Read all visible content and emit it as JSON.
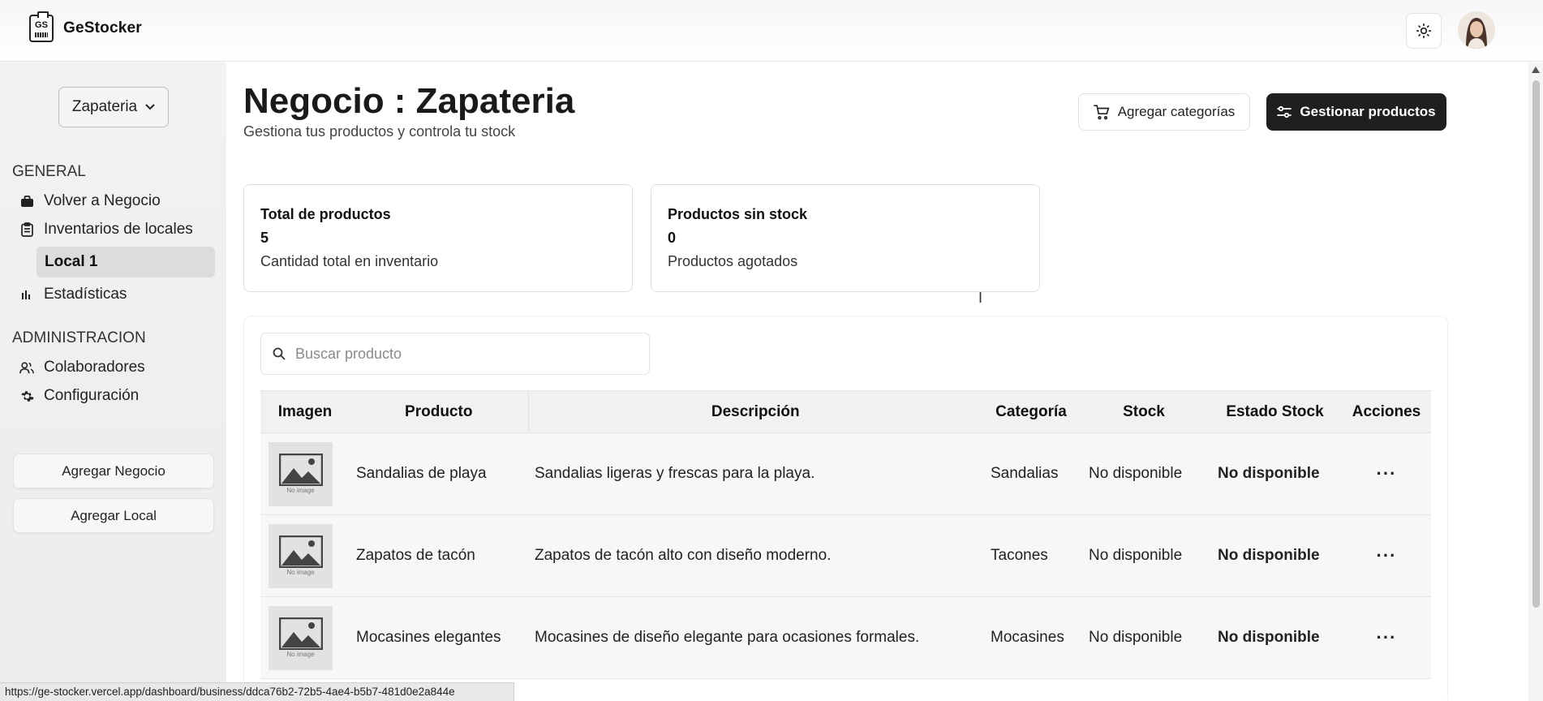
{
  "app": {
    "brand_name": "GeStocker",
    "logo_text": "GS"
  },
  "header": {
    "theme_toggle_icon": "sun-icon",
    "avatar": "user-avatar"
  },
  "sidebar": {
    "business_select": "Zapateria",
    "general_title": "GENERAL",
    "items": [
      {
        "label": "Volver a Negocio",
        "icon": "briefcase-icon"
      },
      {
        "label": "Inventarios de locales",
        "icon": "clipboard-icon"
      },
      {
        "label": "Local 1",
        "icon": ""
      },
      {
        "label": "Estadísticas",
        "icon": "bar-chart-icon"
      }
    ],
    "admin_title": "ADMINISTRACION",
    "admin_items": [
      {
        "label": "Colaboradores",
        "icon": "users-icon"
      },
      {
        "label": "Configuración",
        "icon": "gear-icon"
      }
    ],
    "add_business": "Agregar Negocio",
    "add_local": "Agregar Local"
  },
  "main": {
    "title": "Negocio : Zapateria",
    "subtitle": "Gestiona tus productos y controla tu stock",
    "add_categories": "Agregar categorías",
    "manage_products": "Gestionar productos",
    "cards": [
      {
        "title": "Total de productos",
        "value": "5",
        "desc": "Cantidad total en inventario"
      },
      {
        "title": "Productos sin stock",
        "value": "0",
        "desc": "Productos agotados"
      }
    ],
    "search_placeholder": "Buscar producto",
    "table": {
      "headers": [
        "Imagen",
        "Producto",
        "Descripción",
        "Categoría",
        "Stock",
        "Estado Stock",
        "Acciones"
      ],
      "image_placeholder_text": "No image",
      "rows": [
        {
          "producto": "Sandalias de playa",
          "descripcion": "Sandalias ligeras y frescas para la playa.",
          "categoria": "Sandalias",
          "stock": "No disponible",
          "estado": "No disponible",
          "acciones": "···"
        },
        {
          "producto": "Zapatos de tacón",
          "descripcion": "Zapatos de tacón alto con diseño moderno.",
          "categoria": "Tacones",
          "stock": "No disponible",
          "estado": "No disponible",
          "acciones": "···"
        },
        {
          "producto": "Mocasines elegantes",
          "descripcion": "Mocasines de diseño elegante para ocasiones formales.",
          "categoria": "Mocasines",
          "stock": "No disponible",
          "estado": "No disponible",
          "acciones": "···"
        }
      ]
    }
  },
  "statusbar": {
    "url": "https://ge-stocker.vercel.app/dashboard/business/ddca76b2-72b5-4ae4-b5b7-481d0e2a844e"
  },
  "colors": {
    "primary_dark": "#1f1f1f",
    "sidebar_bg": "#f0f0f0",
    "active_item_bg": "#dcdcdc"
  }
}
